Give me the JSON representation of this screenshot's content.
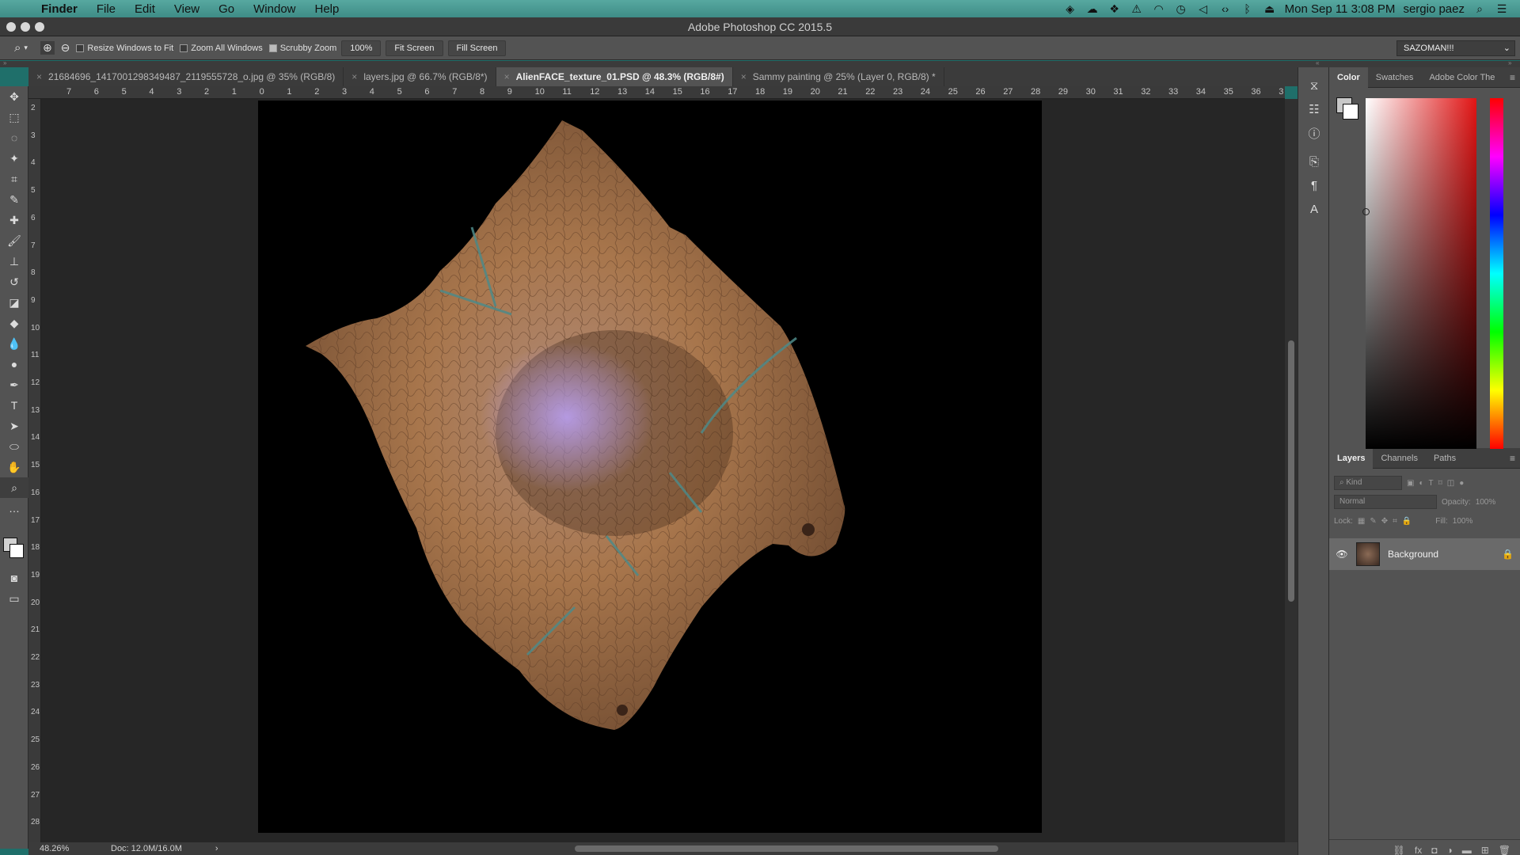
{
  "menubar": {
    "app": "Finder",
    "items": [
      "File",
      "Edit",
      "View",
      "Go",
      "Window",
      "Help"
    ],
    "datetime": "Mon Sep 11  3:08 PM",
    "user": "sergio paez"
  },
  "window": {
    "title": "Adobe Photoshop CC 2015.5"
  },
  "options": {
    "resize_label": "Resize Windows to Fit",
    "zoom_all_label": "Zoom All Windows",
    "scrubby_label": "Scrubby Zoom",
    "btn_100": "100%",
    "btn_fit": "Fit Screen",
    "btn_fill": "Fill Screen",
    "workspace": "SAZOMAN!!!"
  },
  "tabs": [
    {
      "label": "21684696_1417001298349487_2119555728_o.jpg @ 35% (RGB/8)",
      "active": false
    },
    {
      "label": "layers.jpg @ 66.7% (RGB/8*)",
      "active": false
    },
    {
      "label": "AlienFACE_texture_01.PSD @ 48.3% (RGB/8#)",
      "active": true
    },
    {
      "label": "Sammy painting @ 25% (Layer 0, RGB/8) *",
      "active": false
    }
  ],
  "ruler_top": [
    "7",
    "6",
    "5",
    "4",
    "3",
    "2",
    "1",
    "0",
    "1",
    "2",
    "3",
    "4",
    "5",
    "6",
    "7",
    "8",
    "9",
    "10",
    "11",
    "12",
    "13",
    "14",
    "15",
    "16",
    "17",
    "18",
    "19",
    "20",
    "21",
    "22",
    "23",
    "24",
    "25",
    "26",
    "27",
    "28",
    "29",
    "30",
    "31",
    "32",
    "33",
    "34",
    "35",
    "36",
    "3"
  ],
  "ruler_left": [
    "2",
    "3",
    "4",
    "5",
    "6",
    "7",
    "8",
    "9",
    "10",
    "11",
    "12",
    "13",
    "14",
    "15",
    "16",
    "17",
    "18",
    "19",
    "20",
    "21",
    "22",
    "23",
    "24",
    "25",
    "26",
    "27",
    "28"
  ],
  "status": {
    "zoom": "48.26%",
    "doc": "Doc: 12.0M/16.0M"
  },
  "color_panel": {
    "tabs": [
      "Color",
      "Swatches",
      "Adobe Color The"
    ],
    "fg": "#c8c8c8",
    "bg": "#ffffff",
    "hue": "#e11414"
  },
  "layers_panel": {
    "tabs": [
      "Layers",
      "Channels",
      "Paths"
    ],
    "filter_placeholder": "Kind",
    "blend_mode": "Normal",
    "opacity_label": "Opacity:",
    "opacity_value": "100%",
    "lock_label": "Lock:",
    "fill_label": "Fill:",
    "fill_value": "100%",
    "layers": [
      {
        "name": "Background",
        "visible": true,
        "locked": true
      }
    ]
  }
}
